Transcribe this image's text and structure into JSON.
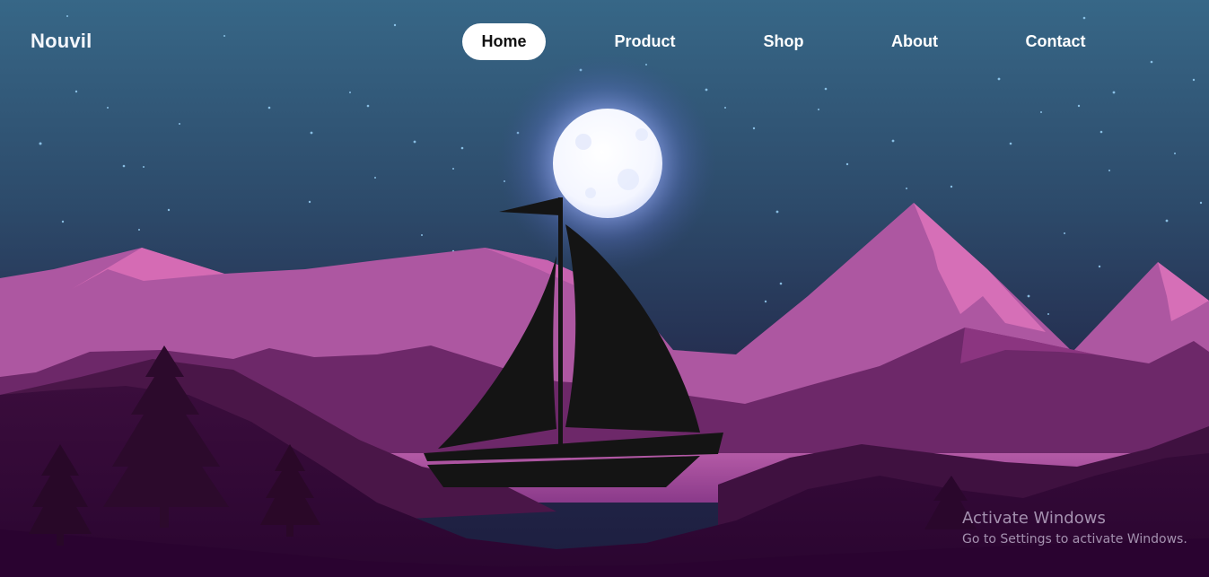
{
  "brand": {
    "name": "Nouvil"
  },
  "nav": {
    "active": "Home",
    "items": [
      {
        "label": "Home"
      },
      {
        "label": "Product"
      },
      {
        "label": "Shop"
      },
      {
        "label": "About"
      },
      {
        "label": "Contact"
      }
    ]
  },
  "hero": {
    "illustration": "night-mountain-lake-sailboat",
    "icons": [
      "moon-icon",
      "sailboat-icon",
      "pine-tree-icon",
      "stars-icon"
    ]
  },
  "watermark": {
    "title": "Activate Windows",
    "subtitle": "Go to Settings to activate Windows."
  },
  "colors": {
    "sky_top": "#356585",
    "sky_bottom": "#1f2647",
    "mountain_pink": "#b15aa3",
    "mountain_highlight": "#d56bb2",
    "mountain_dark": "#5a2058",
    "foreground": "#2a0a2f",
    "boat": "#141414",
    "nav_active_bg": "#ffffff"
  }
}
